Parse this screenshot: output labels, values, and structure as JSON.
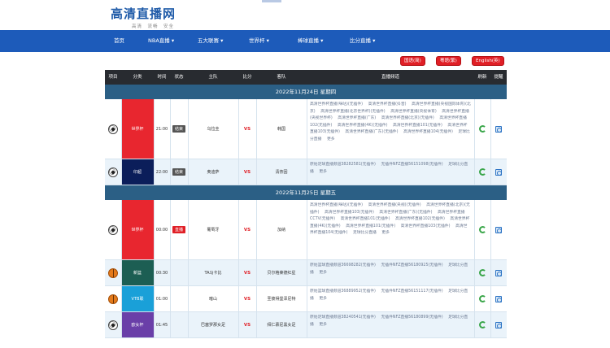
{
  "site": {
    "title": "高清直播网",
    "slogan": "高清　流畅　安全"
  },
  "nav": [
    "首页",
    "NBA直播 ▾",
    "五大联赛 ▾",
    "世界杯 ▾",
    "棒球直播 ▾",
    "比分直播 ▾"
  ],
  "lang_buttons": [
    "国语(简)",
    "粵語(繁)",
    "English(英)"
  ],
  "table": {
    "headers": [
      "项目",
      "分类",
      "时间",
      "状态",
      "主队",
      "比分",
      "客队",
      "直播频道",
      "刷新",
      "提醒"
    ],
    "groups": [
      {
        "date": "2022年11月24日 星期四",
        "rows": [
          {
            "sport": "soccer-icon",
            "league": "世界杯",
            "league_color": "#e8262f",
            "time": "21:00",
            "status": "结束",
            "status_color": "#555555",
            "home": "乌拉圭",
            "vs": "VS",
            "away": "韩国",
            "channels": [
              "高清世界杯直播(咪咕)(无插件)",
              "高清世界杯直播(抖音)",
              "高清世界杯直播(央视国际体育)(北京)",
              "高清世界杯直播(北京世界杯)(无插件)",
              "高清世界杯直播(央视体育)",
              "高清世界杯直播(央视世界杯)",
              "高清世界杯直播(广东)",
              "高清世界杯直播(北京)(无插件)",
              "高清世界杯直播102(无插件)",
              "高清世界杯直播(4K)(无插件)",
              "高清世界杯直播101(无插件)",
              "高清世界杯直播103(无插件)",
              "高清世界杯直播(广东)(无插件)",
              "高清世界杯直播104(无插件)",
              "足球比分直播",
              "更多"
            ],
            "alt": false
          },
          {
            "sport": "soccer-icon",
            "league": "印超",
            "league_color": "#0b1e5a",
            "time": "22:00",
            "status": "结束",
            "status_color": "#555555",
            "home": "奥迪萨",
            "vs": "VS",
            "away": "清奈因",
            "channels": [
              "原始足球直播频道38282581(无插件)",
              "无插件NFZ直播56151098(无插件)",
              "足球比分直播",
              "更多"
            ],
            "alt": true
          }
        ]
      },
      {
        "date": "2022年11月25日 星期五",
        "rows": [
          {
            "sport": "soccer-icon",
            "league": "世界杯",
            "league_color": "#e8262f",
            "time": "00:00",
            "status": "直播",
            "status_color": "#e01f26",
            "home": "葡萄牙",
            "vs": "VS",
            "away": "加纳",
            "channels": [
              "高清世界杯直播(咪咕)(无插件)",
              "高清世界杯直播(央视)(无插件)",
              "高清世界杯直播(北京)(无插件)",
              "高清世界杯直播103(无插件)",
              "高清世界杯直播(广东)(无插件)",
              "高清世界杯直播CCTV(无插件)",
              "高清世界杯直播101(无插件)",
              "高清世界杯直播102(无插件)",
              "高清世界杯直播(4K)(无插件)",
              "高清世界杯直播101(无插件)",
              "高清世界杯直播103(无插件)",
              "高清世界杯直播104(无插件)",
              "足球比分直播",
              "更多"
            ],
            "alt": false
          },
          {
            "sport": "basketball-icon",
            "league": "新篮",
            "league_color": "#1c5e53",
            "time": "00:30",
            "status": "",
            "status_color": "",
            "home": "TA马卡比",
            "vs": "VS",
            "away": "贝尔格莱德红星",
            "channels": [
              "原始篮球直播频道36698282(无插件)",
              "无插件NFZ直播56180925(无插件)",
              "足球比分直播",
              "更多"
            ],
            "alt": true
          },
          {
            "sport": "basketball-icon",
            "league": "VTB联",
            "league_color": "#1aa0d8",
            "time": "01:00",
            "status": "",
            "status_color": "",
            "home": "喀山",
            "vs": "VS",
            "away": "圣彼得堡泽尼特",
            "channels": [
              "原始篮球直播频道36889952(无插件)",
              "无插件NFZ直播56151117(无插件)",
              "足球比分直播",
              "更多"
            ],
            "alt": false
          },
          {
            "sport": "soccer-icon",
            "league": "欧女杯",
            "league_color": "#6a3fa8",
            "time": "01:45",
            "status": "",
            "status_color": "",
            "home": "巴塞罗那女足",
            "vs": "VS",
            "away": "拜仁慕尼黑女足",
            "channels": [
              "原始足球直播频道38240541(无插件)",
              "无插件NFZ直播56180899(无插件)",
              "足球比分直播",
              "更多"
            ],
            "alt": true
          }
        ]
      }
    ]
  }
}
